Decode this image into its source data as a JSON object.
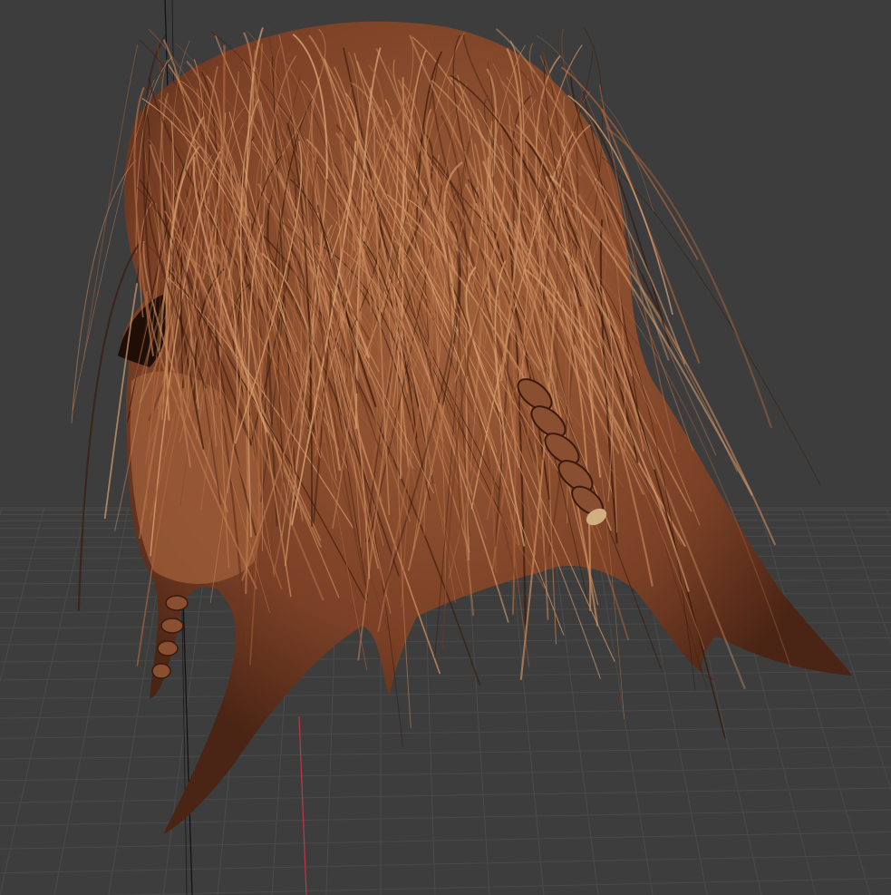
{
  "viewport": {
    "background_color": "#3d3d3d",
    "grid_color": "#4a4a4a",
    "axis_x_color": "#c0364a",
    "axis_z_color": "#111111",
    "hair_base_color": "#8a4a2c",
    "hair_highlight_color": "#c98a5c",
    "hair_shadow_color": "#2e140a"
  }
}
